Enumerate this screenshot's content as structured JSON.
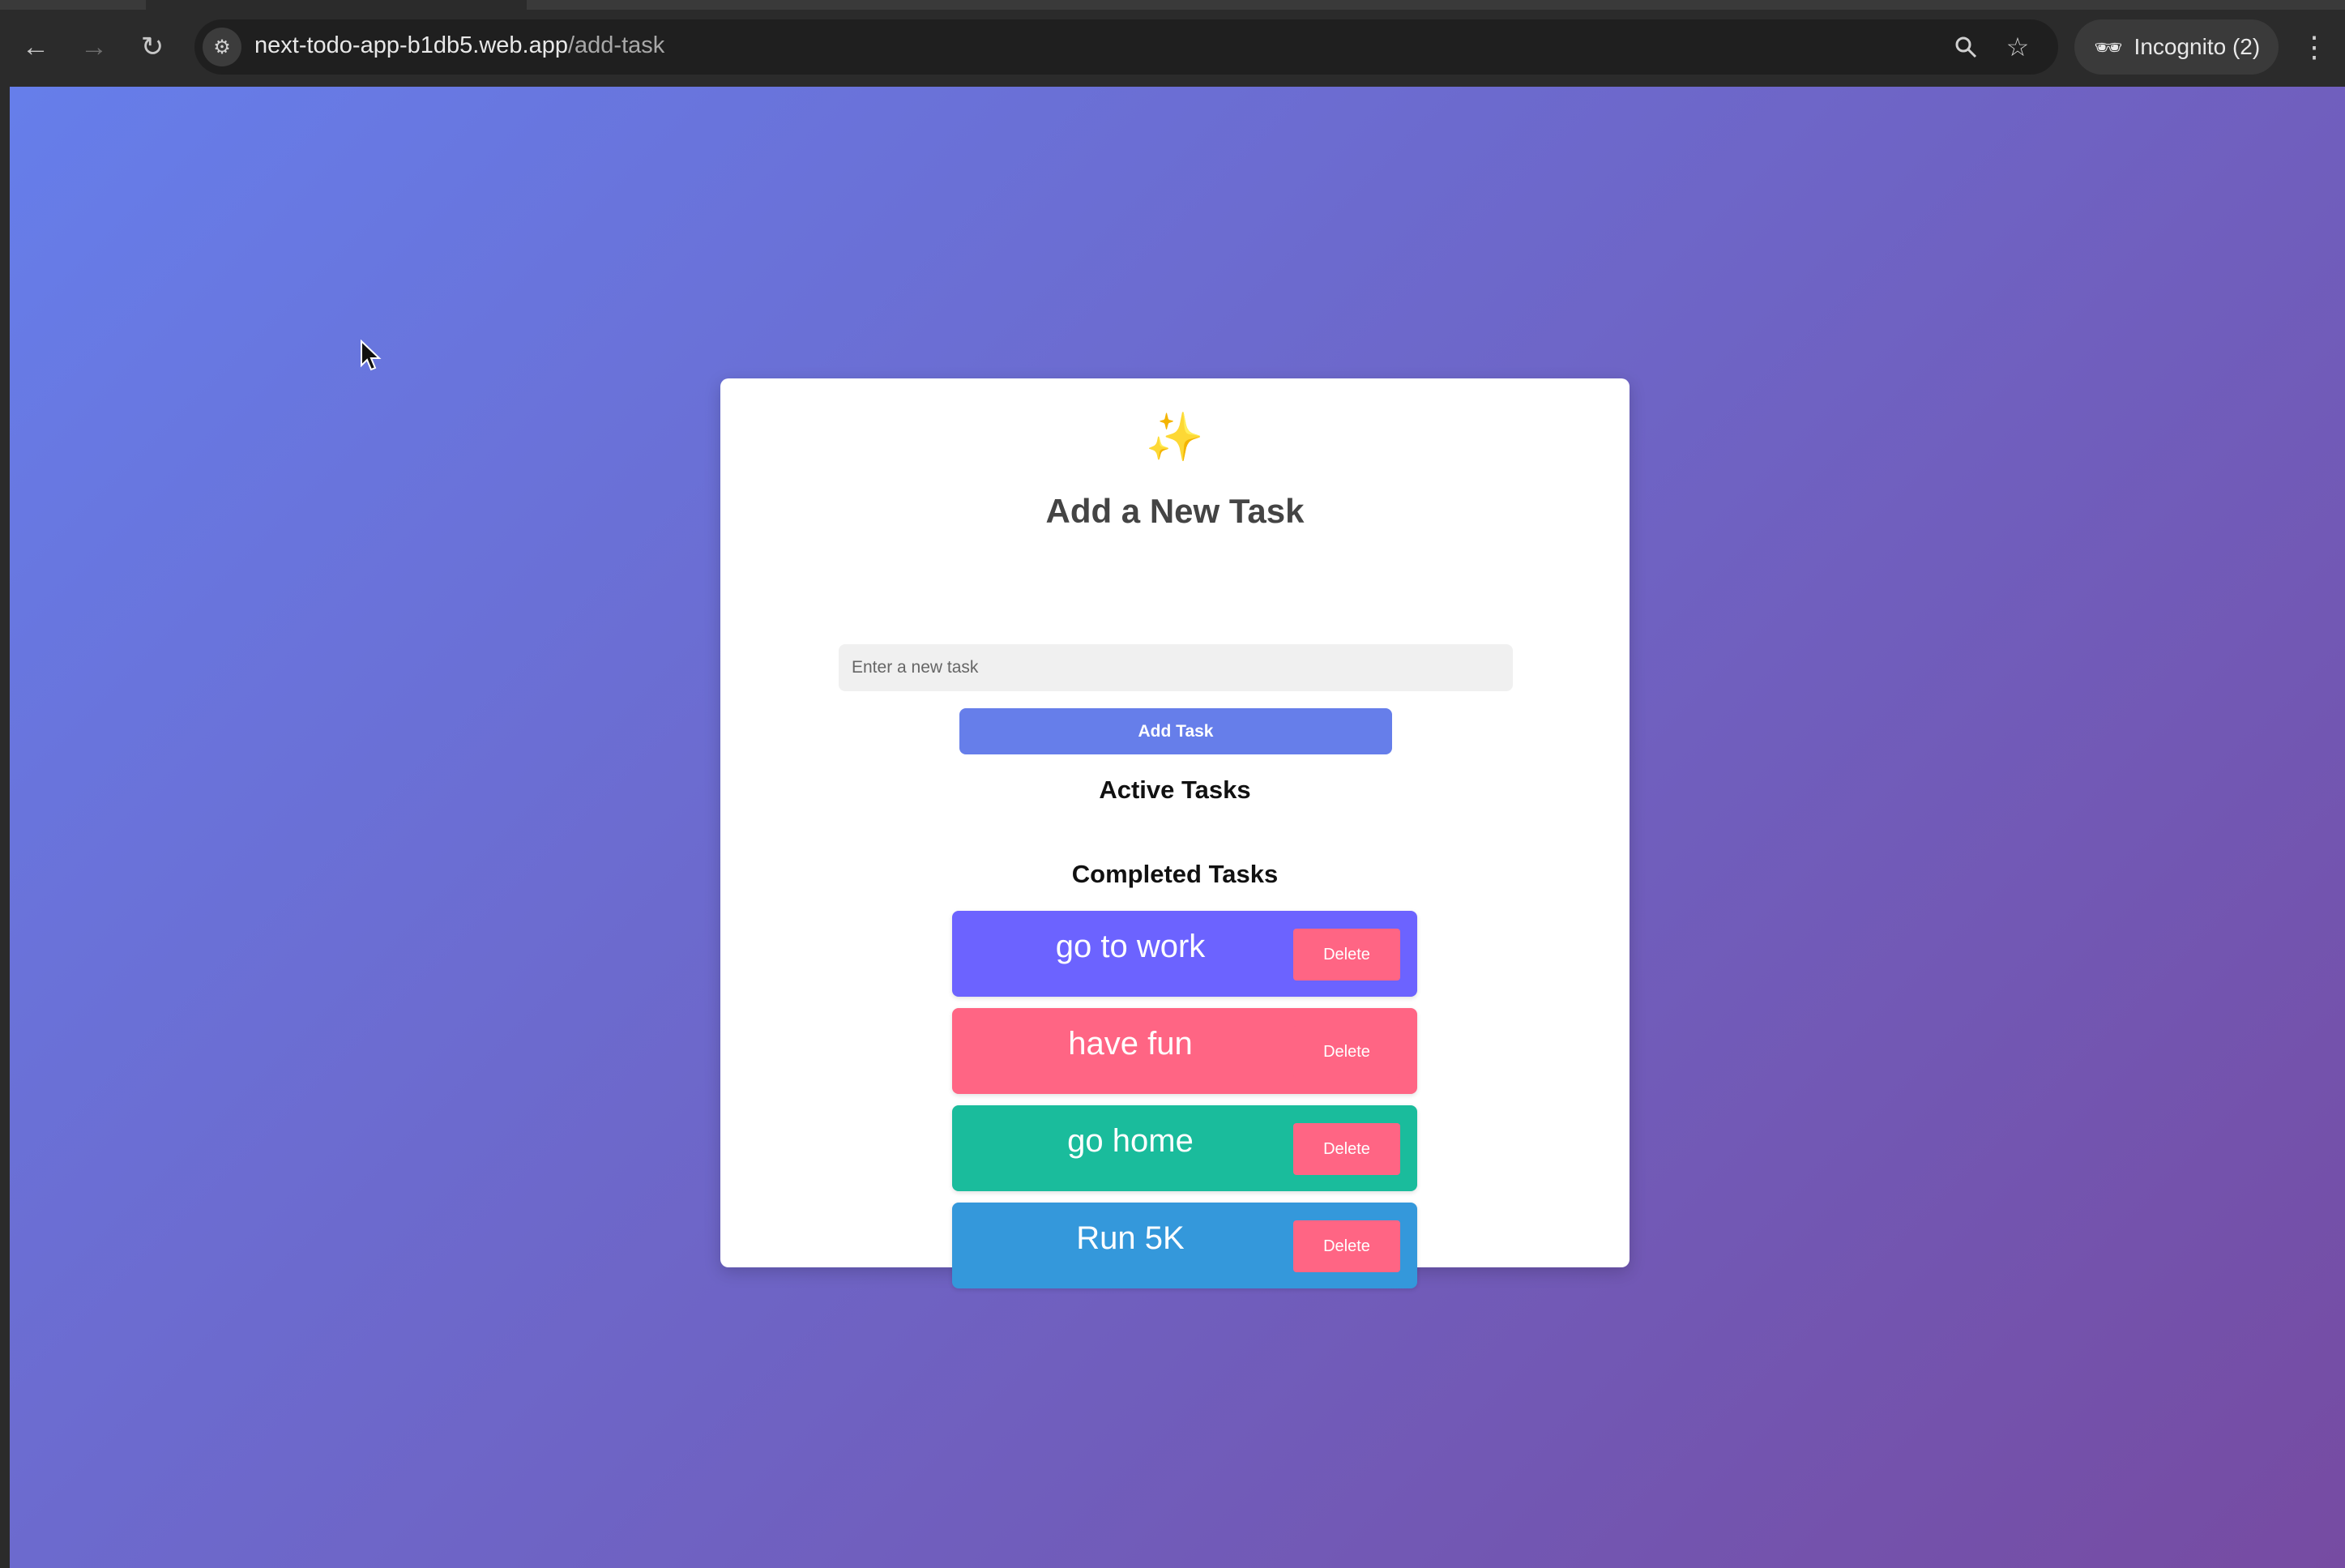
{
  "browser": {
    "url_host": "next-todo-app-b1db5.web.app",
    "url_path": "/add-task",
    "profile_label": "Incognito (2)",
    "icons": {
      "back": "arrow-left",
      "forward": "arrow-right",
      "reload": "reload",
      "site_info": "tune",
      "zoom": "search",
      "bookmark": "star",
      "incognito": "incognito",
      "menu": "vertical-dots"
    }
  },
  "page": {
    "background_gradient": [
      "#667eea",
      "#764ba2"
    ],
    "card": {
      "emoji": "✨",
      "title": "Add a New Task",
      "input": {
        "placeholder": "Enter a new task",
        "value": ""
      },
      "add_button_label": "Add Task",
      "active_heading": "Active Tasks",
      "completed_heading": "Completed Tasks",
      "completed_tasks": [
        {
          "text": "go to work",
          "color": "#6c63ff",
          "delete_label": "Delete"
        },
        {
          "text": "have fun",
          "color": "#ff6584",
          "delete_label": "Delete"
        },
        {
          "text": "go home",
          "color": "#1abc9c",
          "delete_label": "Delete"
        },
        {
          "text": "Run 5K",
          "color": "#3498db",
          "delete_label": "Delete"
        }
      ]
    },
    "accent_colors": {
      "primary": "#667eea",
      "delete": "#ff6584"
    }
  }
}
